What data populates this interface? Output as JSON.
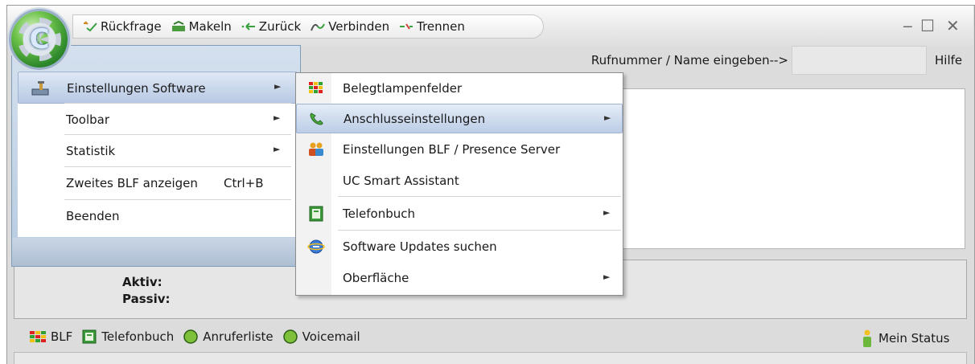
{
  "quickbar": {
    "rueckfrage": "Rückfrage",
    "makeln": "Makeln",
    "zurueck": "Zurück",
    "verbinden": "Verbinden",
    "trennen": "Trennen"
  },
  "window_controls": {
    "minimize": "‒",
    "maximize": "☐",
    "close": "✕"
  },
  "search": {
    "label": "Rufnummer / Name eingeben-->",
    "value": "",
    "help": "Hilfe"
  },
  "main_menu": {
    "items": [
      {
        "label": "Einstellungen Software",
        "icon": "settings-tool-icon",
        "submenu": true,
        "highlighted": true
      },
      {
        "label": "Toolbar",
        "submenu": true
      },
      {
        "label": "Statistik",
        "submenu": true
      },
      {
        "label": "Zweites BLF anzeigen",
        "shortcut": "Ctrl+B"
      },
      {
        "label": "Beenden"
      }
    ]
  },
  "sub_menu": {
    "items": [
      {
        "label": "Belegtlampenfelder",
        "icon": "blf-grid-icon"
      },
      {
        "label": "Anschlusseinstellungen",
        "icon": "phone-icon",
        "submenu": true,
        "highlighted": true
      },
      {
        "label": "Einstellungen BLF / Presence Server",
        "icon": "users-icon"
      },
      {
        "label": "UC Smart Assistant"
      },
      {
        "label": "Telefonbuch",
        "icon": "phonebook-icon",
        "submenu": true
      },
      {
        "label": "Software Updates suchen",
        "icon": "globe-icon"
      },
      {
        "label": "Oberfläche",
        "submenu": true
      }
    ],
    "arrow": "►"
  },
  "status_panel": {
    "aktiv": "Aktiv:",
    "passiv": "Passiv:"
  },
  "bottom_bar": {
    "blf": "BLF",
    "telefonbuch": "Telefonbuch",
    "anruferliste": "Anruferliste",
    "voicemail": "Voicemail",
    "mein_status": "Mein Status"
  },
  "colors": {
    "accent_green": "#5cb83a",
    "menu_highlight": "#bccde6",
    "menu_border": "#7f9db9"
  }
}
